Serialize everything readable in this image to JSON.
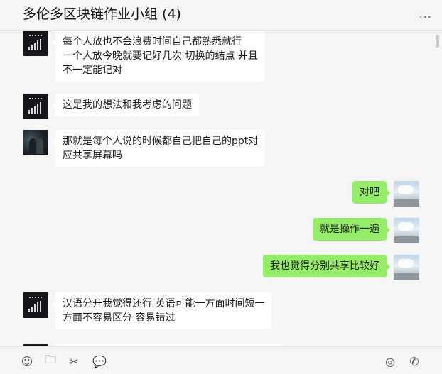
{
  "header": {
    "title": "多伦多区块链作业小组 (4)",
    "more_label": "..."
  },
  "messages": [
    {
      "side": "left",
      "avatar": "dark-chart-avatar",
      "lines": [
        "每个人放也不会浪费时间自己都熟悉就行",
        "一个人放今晚就要记好几次 切换的结点  并且",
        "不一定能记对"
      ]
    },
    {
      "side": "left",
      "avatar": "dark-chart-avatar",
      "lines": [
        "这是我的想法和我考虑的问题"
      ]
    },
    {
      "side": "left",
      "avatar": "night-photo-avatar",
      "lines": [
        "那就是每个人说的时候都自己把自己的ppt对",
        "应共享屏幕吗"
      ]
    },
    {
      "side": "right",
      "avatar": "sky-photo-avatar",
      "lines": [
        "对吧"
      ]
    },
    {
      "side": "right",
      "avatar": "sky-photo-avatar",
      "lines": [
        "就是操作一遍"
      ]
    },
    {
      "side": "right",
      "avatar": "sky-photo-avatar",
      "lines": [
        "我也觉得分别共享比较好"
      ]
    },
    {
      "side": "left",
      "avatar": "dark-chart-avatar",
      "lines": [
        "汉语分开我觉得还行 英语可能一方面时间短一",
        "方面不容易区分 容易错过"
      ]
    }
  ],
  "toolbar": {
    "emoji": "☺",
    "folder": "🗀",
    "scissors": "✂",
    "chat": "💬",
    "live": "◎",
    "call": "✆"
  }
}
